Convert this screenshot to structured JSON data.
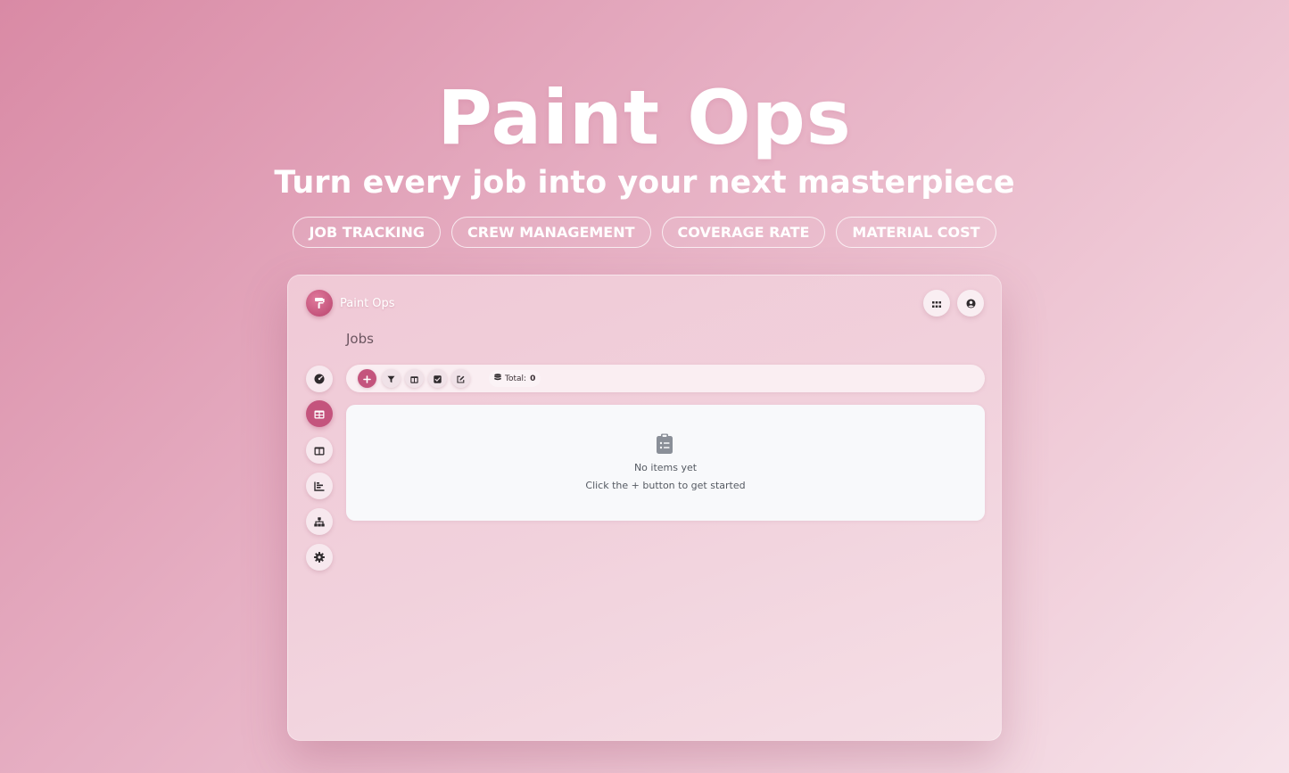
{
  "hero": {
    "title": "Paint Ops",
    "subtitle": "Turn every job into your next masterpiece",
    "tags": [
      "JOB TRACKING",
      "CREW MANAGEMENT",
      "COVERAGE RATE",
      "MATERIAL COST"
    ]
  },
  "app": {
    "brand_name": "Paint Ops",
    "page_title": "Jobs",
    "header_icons": [
      "apps-grid-icon",
      "user-circle-icon"
    ],
    "sidebar_icons": [
      "dashboard-gauge-icon",
      "table-icon",
      "columns-icon",
      "chart-icon",
      "sitemap-icon",
      "gear-icon"
    ],
    "sidebar_active": "table-icon",
    "toolbar": {
      "icons": [
        "plus-icon",
        "filter-icon",
        "columns-icon",
        "checkbox-icon",
        "edit-icon",
        "database-icon"
      ],
      "total_label": "Total:",
      "total_value": "0"
    },
    "empty_state": {
      "icon": "clipboard-list-icon",
      "title": "No items yet",
      "hint": "Click the + button to get started"
    }
  },
  "colors": {
    "accent": "#c4547d",
    "background_start": "#d98aa5",
    "background_end": "#f6e3ea",
    "panel": "#f8f9fb"
  }
}
